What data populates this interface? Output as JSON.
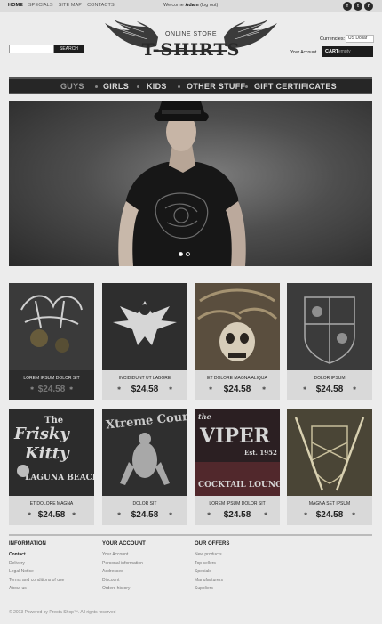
{
  "topnav": {
    "items": [
      "Home",
      "Specials",
      "Site Map",
      "Contacts"
    ]
  },
  "welcome": {
    "prefix": "Welcome",
    "user": "Adam",
    "suffix": "(log out)"
  },
  "social": [
    "f",
    "t",
    "r"
  ],
  "search": {
    "placeholder": "",
    "button": "Search"
  },
  "logo": {
    "subtitle": "Online Store",
    "title": "T-SHIRTS"
  },
  "currency": {
    "label": "Currencies:",
    "selected": "US Dollar"
  },
  "account": {
    "label": "Your Account"
  },
  "cart": {
    "label": "CART",
    "value": "empty"
  },
  "menu": [
    "Guys",
    "Girls",
    "Kids",
    "Other Stuff",
    "Gift Certificates"
  ],
  "products": [
    {
      "name": "Lorem ipsum dolor sit",
      "price": "$24.58"
    },
    {
      "name": "Incididunt ut labore",
      "price": "$24.58"
    },
    {
      "name": "Et dolore magna aliqua",
      "price": "$24.58"
    },
    {
      "name": "Dolor ipsum",
      "price": "$24.58"
    },
    {
      "name": "Et dolore magna",
      "price": "$24.58"
    },
    {
      "name": "Dolor sit",
      "price": "$24.58"
    },
    {
      "name": "Lorem ipsum dolor sit",
      "price": "$24.58"
    },
    {
      "name": "Magna set ipsum",
      "price": "$24.58"
    }
  ],
  "footer": {
    "information": {
      "title": "Information",
      "links": [
        "Contact",
        "Delivery",
        "Legal Notice",
        "Terms and conditions of use",
        "About us"
      ]
    },
    "account": {
      "title": "Your Account",
      "links": [
        "Your Account",
        "Personal information",
        "Addresses",
        "Discount",
        "Orders history"
      ]
    },
    "offers": {
      "title": "Our Offers",
      "links": [
        "New products",
        "Top sellers",
        "Specials",
        "Manufacturers",
        "Suppliers"
      ]
    },
    "copyright": "© 2013 Powered by Presta Shop™. All rights reserved"
  }
}
